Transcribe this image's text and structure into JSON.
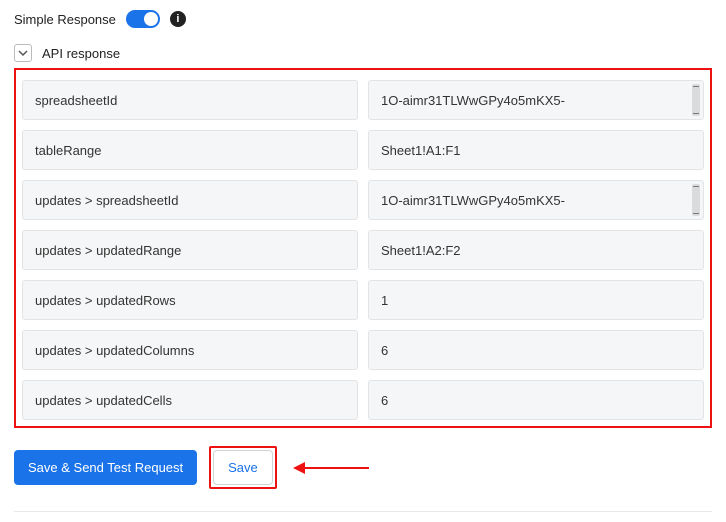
{
  "header": {
    "simple_response_label": "Simple Response"
  },
  "section": {
    "title": "API response"
  },
  "rows": [
    {
      "key": "spreadsheetId",
      "val": "1O-aimr31TLWwGPy4o5mKX5-",
      "scroll": true
    },
    {
      "key": "tableRange",
      "val": "Sheet1!A1:F1",
      "scroll": false
    },
    {
      "key": "updates > spreadsheetId",
      "val": "1O-aimr31TLWwGPy4o5mKX5-",
      "scroll": true
    },
    {
      "key": "updates > updatedRange",
      "val": "Sheet1!A2:F2",
      "scroll": false
    },
    {
      "key": "updates > updatedRows",
      "val": "1",
      "scroll": false
    },
    {
      "key": "updates > updatedColumns",
      "val": "6",
      "scroll": false
    },
    {
      "key": "updates > updatedCells",
      "val": "6",
      "scroll": false
    }
  ],
  "buttons": {
    "primary": "Save & Send Test Request",
    "secondary": "Save"
  }
}
